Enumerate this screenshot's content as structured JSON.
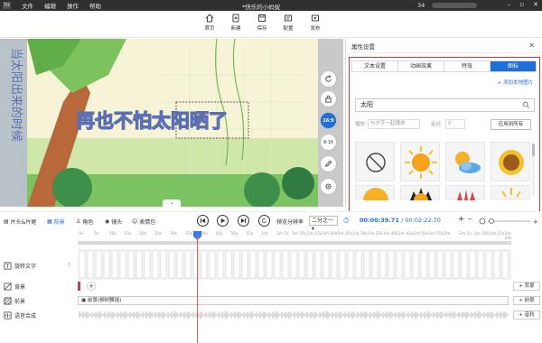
{
  "titlebar": {
    "logo": "TH",
    "menu": [
      "文件",
      "编辑",
      "操作",
      "帮助"
    ],
    "title": "*快乐的小蚂蚁",
    "account": "34"
  },
  "toolbar": {
    "buttons": [
      {
        "label": "首页",
        "icon": "home-icon"
      },
      {
        "label": "新建",
        "icon": "new-file-icon"
      },
      {
        "label": "保存",
        "icon": "save-icon"
      },
      {
        "label": "配置",
        "icon": "config-icon"
      },
      {
        "label": "发布",
        "icon": "publish-icon"
      }
    ]
  },
  "preview": {
    "caption": "再也不怕太阳晒了",
    "side_left_text": "当太阳出来的时候",
    "ratio_active": "16:9",
    "ratio_alt": "9:16"
  },
  "props": {
    "title": "属性设置",
    "tabs": [
      "文本设置",
      "动画效果",
      "特效",
      "图标"
    ],
    "active_tab": 3,
    "add_sticker": "+ 添加本地图片",
    "search_value": "太阳",
    "option_1_label": "播放:",
    "option_1_value": "与文字一起播放",
    "option_2_label": "延迟:",
    "option_2_value": "0",
    "apply_all": "应用到所有"
  },
  "timeline": {
    "controls": [
      {
        "label": "片头&片尾",
        "icon": "clip-icon"
      },
      {
        "label": "前景",
        "icon": "foreground-icon",
        "active": true
      },
      {
        "label": "角色",
        "icon": "role-icon"
      },
      {
        "label": "镜头",
        "icon": "camera-icon"
      },
      {
        "label": "表情包",
        "icon": "emoji-icon"
      }
    ],
    "preview_rate_label": "预览分辨率",
    "preview_rate_value": "二分之一",
    "current_time": "00:00:39.71",
    "total_time": "/ 00:02:22.70",
    "ruler_ticks": [
      "0s",
      "5s",
      "10s",
      "15s",
      "20s",
      "25s",
      "30s",
      "35s",
      "40s",
      "45s",
      "50s",
      "55s",
      "1m",
      "1m 5s",
      "1m 10s",
      "1m 15s",
      "1m 20s",
      "1m 25s",
      "1m 30s",
      "1m 35s",
      "1m 40s",
      "1m 45s",
      "1m 50s",
      "1m 55s",
      "2m",
      "2m 5s",
      "2m 10s",
      "2m 15s",
      "2m 20s"
    ],
    "tracks": [
      {
        "label": "旋转文字",
        "help": "?",
        "icon": "text-track-icon"
      },
      {
        "label": "背景",
        "button": "+ 背景",
        "icon": "background-icon"
      },
      {
        "label": "前景",
        "button": "+ 前景",
        "clip": "前景(柳树飘摇)",
        "icon": "foreground-track-icon"
      },
      {
        "label": "语音合成",
        "button": "+ 音轨",
        "icon": "audio-icon"
      }
    ]
  },
  "colors": {
    "accent": "#1e6fd9",
    "highlight_border": "#e23030",
    "playhead": "#ff4d4d"
  }
}
